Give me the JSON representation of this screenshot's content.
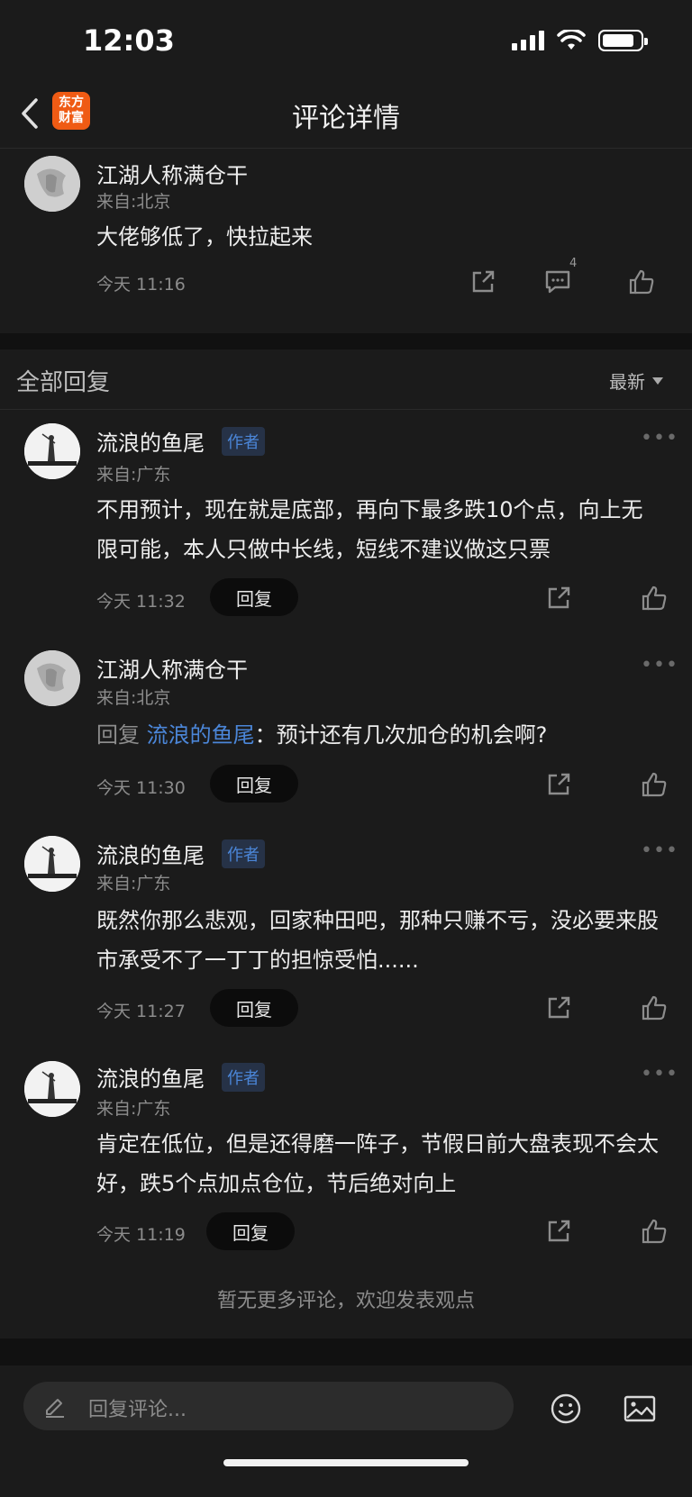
{
  "status_bar": {
    "time": "12:03"
  },
  "nav": {
    "title": "评论详情",
    "logo_line1": "东方",
    "logo_line2": "财富"
  },
  "main_comment": {
    "username": "江湖人称满仓干",
    "location": "来自:北京",
    "content": "大佬够低了，快拉起来",
    "time": "今天 11:16",
    "comment_count": "4"
  },
  "replies_header": {
    "title": "全部回复",
    "sort_label": "最新"
  },
  "replies": [
    {
      "username": "流浪的鱼尾",
      "author_badge": "作者",
      "location": "来自:广东",
      "content": "不用预计，现在就是底部，再向下最多跌10个点，向上无限可能，本人只做中长线，短线不建议做这只票",
      "time": "今天 11:32",
      "reply_label": "回复"
    },
    {
      "username": "江湖人称满仓干",
      "location": "来自:北京",
      "reply_prefix": "回复",
      "reply_target": "流浪的鱼尾",
      "content": "：预计还有几次加仓的机会啊?",
      "time": "今天 11:30",
      "reply_label": "回复"
    },
    {
      "username": "流浪的鱼尾",
      "author_badge": "作者",
      "location": "来自:广东",
      "content": "既然你那么悲观，回家种田吧，那种只赚不亏，没必要来股市承受不了一丁丁的担惊受怕......",
      "time": "今天 11:27",
      "reply_label": "回复"
    },
    {
      "username": "流浪的鱼尾",
      "author_badge": "作者",
      "location": "来自:广东",
      "content": "肯定在低位，但是还得磨一阵子，节假日前大盘表现不会太好，跌5个点加点仓位，节后绝对向上",
      "time": "今天 11:19",
      "reply_label": "回复"
    }
  ],
  "footer": {
    "no_more": "暂无更多评论，欢迎发表观点"
  },
  "bottom_bar": {
    "input_placeholder": "回复评论..."
  },
  "icons": {
    "back": "chevron-left-icon",
    "share": "share-icon",
    "comment": "comment-icon",
    "like": "thumbs-up-icon",
    "more": "more-dots-icon",
    "emoji": "emoji-icon",
    "image": "image-icon",
    "pencil": "pencil-icon"
  },
  "colors": {
    "background": "#1b1b1b",
    "accent_blue": "#4b86d8",
    "brand_orange": "#ef5b14"
  }
}
